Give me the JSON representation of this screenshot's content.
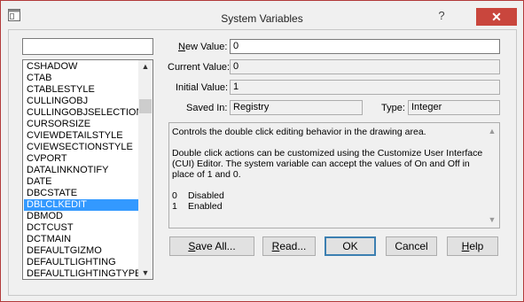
{
  "window": {
    "title": "System Variables",
    "help_symbol": "?",
    "close_symbol": "✕"
  },
  "search": {
    "value": ""
  },
  "variables": [
    "CSHADOW",
    "CTAB",
    "CTABLESTYLE",
    "CULLINGOBJ",
    "CULLINGOBJSELECTION",
    "CURSORSIZE",
    "CVIEWDETAILSTYLE",
    "CVIEWSECTIONSTYLE",
    "CVPORT",
    "DATALINKNOTIFY",
    "DATE",
    "DBCSTATE",
    "DBLCLKEDIT",
    "DBMOD",
    "DCTCUST",
    "DCTMAIN",
    "DEFAULTGIZMO",
    "DEFAULTLIGHTING",
    "DEFAULTLIGHTINGTYPE"
  ],
  "selected_variable": "DBLCLKEDIT",
  "fields": {
    "new_value": {
      "label_access": "N",
      "label_rest": "ew Value:",
      "value": "0"
    },
    "current_value": {
      "label": "Current Value:",
      "value": "0"
    },
    "initial_value": {
      "label": "Initial Value:",
      "value": "1"
    },
    "saved_in": {
      "label": "Saved In:",
      "value": "Registry"
    },
    "type": {
      "label": "Type:",
      "value": "Integer"
    }
  },
  "description": {
    "line1": "Controls the double click editing behavior in the drawing area.",
    "para2": "Double click actions can be customized using the Customize User Interface (CUI) Editor. The system variable can accept the values of On and Off in place of 1 and 0.",
    "opt0_num": "0",
    "opt0_label": "Disabled",
    "opt1_num": "1",
    "opt1_label": "Enabled"
  },
  "buttons": {
    "save_all": {
      "access": "S",
      "rest": "ave All..."
    },
    "read": {
      "access": "R",
      "rest": "ead..."
    },
    "ok": "OK",
    "cancel": "Cancel",
    "help": {
      "access": "H",
      "rest": "elp"
    }
  }
}
